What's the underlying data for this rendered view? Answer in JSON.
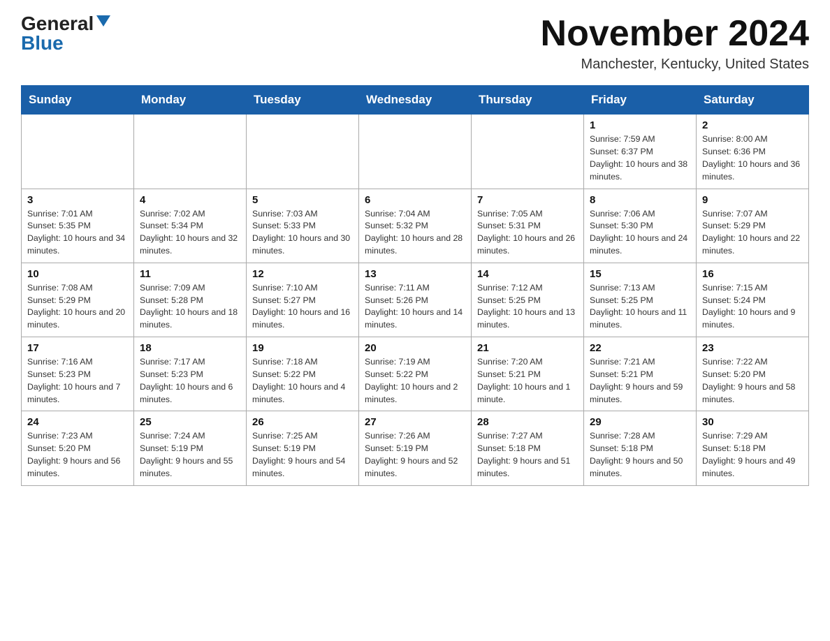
{
  "header": {
    "logo_general": "General",
    "logo_blue": "Blue",
    "month_title": "November 2024",
    "location": "Manchester, Kentucky, United States"
  },
  "days_of_week": [
    "Sunday",
    "Monday",
    "Tuesday",
    "Wednesday",
    "Thursday",
    "Friday",
    "Saturday"
  ],
  "weeks": [
    [
      {
        "day": "",
        "info": ""
      },
      {
        "day": "",
        "info": ""
      },
      {
        "day": "",
        "info": ""
      },
      {
        "day": "",
        "info": ""
      },
      {
        "day": "",
        "info": ""
      },
      {
        "day": "1",
        "info": "Sunrise: 7:59 AM\nSunset: 6:37 PM\nDaylight: 10 hours and 38 minutes."
      },
      {
        "day": "2",
        "info": "Sunrise: 8:00 AM\nSunset: 6:36 PM\nDaylight: 10 hours and 36 minutes."
      }
    ],
    [
      {
        "day": "3",
        "info": "Sunrise: 7:01 AM\nSunset: 5:35 PM\nDaylight: 10 hours and 34 minutes."
      },
      {
        "day": "4",
        "info": "Sunrise: 7:02 AM\nSunset: 5:34 PM\nDaylight: 10 hours and 32 minutes."
      },
      {
        "day": "5",
        "info": "Sunrise: 7:03 AM\nSunset: 5:33 PM\nDaylight: 10 hours and 30 minutes."
      },
      {
        "day": "6",
        "info": "Sunrise: 7:04 AM\nSunset: 5:32 PM\nDaylight: 10 hours and 28 minutes."
      },
      {
        "day": "7",
        "info": "Sunrise: 7:05 AM\nSunset: 5:31 PM\nDaylight: 10 hours and 26 minutes."
      },
      {
        "day": "8",
        "info": "Sunrise: 7:06 AM\nSunset: 5:30 PM\nDaylight: 10 hours and 24 minutes."
      },
      {
        "day": "9",
        "info": "Sunrise: 7:07 AM\nSunset: 5:29 PM\nDaylight: 10 hours and 22 minutes."
      }
    ],
    [
      {
        "day": "10",
        "info": "Sunrise: 7:08 AM\nSunset: 5:29 PM\nDaylight: 10 hours and 20 minutes."
      },
      {
        "day": "11",
        "info": "Sunrise: 7:09 AM\nSunset: 5:28 PM\nDaylight: 10 hours and 18 minutes."
      },
      {
        "day": "12",
        "info": "Sunrise: 7:10 AM\nSunset: 5:27 PM\nDaylight: 10 hours and 16 minutes."
      },
      {
        "day": "13",
        "info": "Sunrise: 7:11 AM\nSunset: 5:26 PM\nDaylight: 10 hours and 14 minutes."
      },
      {
        "day": "14",
        "info": "Sunrise: 7:12 AM\nSunset: 5:25 PM\nDaylight: 10 hours and 13 minutes."
      },
      {
        "day": "15",
        "info": "Sunrise: 7:13 AM\nSunset: 5:25 PM\nDaylight: 10 hours and 11 minutes."
      },
      {
        "day": "16",
        "info": "Sunrise: 7:15 AM\nSunset: 5:24 PM\nDaylight: 10 hours and 9 minutes."
      }
    ],
    [
      {
        "day": "17",
        "info": "Sunrise: 7:16 AM\nSunset: 5:23 PM\nDaylight: 10 hours and 7 minutes."
      },
      {
        "day": "18",
        "info": "Sunrise: 7:17 AM\nSunset: 5:23 PM\nDaylight: 10 hours and 6 minutes."
      },
      {
        "day": "19",
        "info": "Sunrise: 7:18 AM\nSunset: 5:22 PM\nDaylight: 10 hours and 4 minutes."
      },
      {
        "day": "20",
        "info": "Sunrise: 7:19 AM\nSunset: 5:22 PM\nDaylight: 10 hours and 2 minutes."
      },
      {
        "day": "21",
        "info": "Sunrise: 7:20 AM\nSunset: 5:21 PM\nDaylight: 10 hours and 1 minute."
      },
      {
        "day": "22",
        "info": "Sunrise: 7:21 AM\nSunset: 5:21 PM\nDaylight: 9 hours and 59 minutes."
      },
      {
        "day": "23",
        "info": "Sunrise: 7:22 AM\nSunset: 5:20 PM\nDaylight: 9 hours and 58 minutes."
      }
    ],
    [
      {
        "day": "24",
        "info": "Sunrise: 7:23 AM\nSunset: 5:20 PM\nDaylight: 9 hours and 56 minutes."
      },
      {
        "day": "25",
        "info": "Sunrise: 7:24 AM\nSunset: 5:19 PM\nDaylight: 9 hours and 55 minutes."
      },
      {
        "day": "26",
        "info": "Sunrise: 7:25 AM\nSunset: 5:19 PM\nDaylight: 9 hours and 54 minutes."
      },
      {
        "day": "27",
        "info": "Sunrise: 7:26 AM\nSunset: 5:19 PM\nDaylight: 9 hours and 52 minutes."
      },
      {
        "day": "28",
        "info": "Sunrise: 7:27 AM\nSunset: 5:18 PM\nDaylight: 9 hours and 51 minutes."
      },
      {
        "day": "29",
        "info": "Sunrise: 7:28 AM\nSunset: 5:18 PM\nDaylight: 9 hours and 50 minutes."
      },
      {
        "day": "30",
        "info": "Sunrise: 7:29 AM\nSunset: 5:18 PM\nDaylight: 9 hours and 49 minutes."
      }
    ]
  ]
}
